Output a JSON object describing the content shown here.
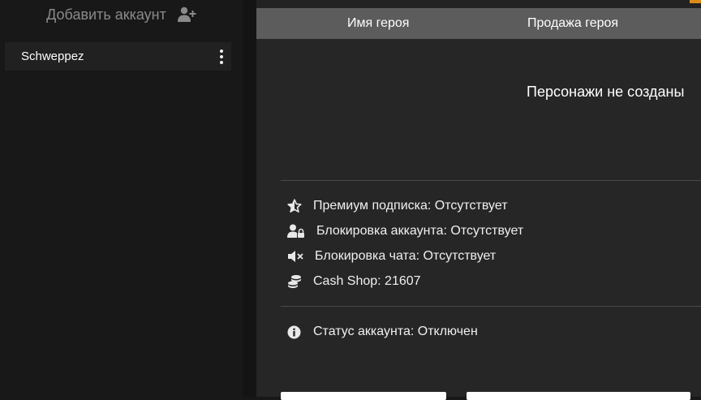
{
  "sidebar": {
    "add_account_label": "Добавить аккаунт",
    "accounts": [
      {
        "name": "Schweppez"
      }
    ]
  },
  "heroes_table": {
    "columns": [
      "Имя героя",
      "Продажа героя"
    ],
    "empty_message": "Персонажи не созданы"
  },
  "account_info": {
    "premium": "Премиум подписка: Отсутствует",
    "account_block": "Блокировка аккаунта: Отсутствует",
    "chat_block": "Блокировка чата: Отсутствует",
    "cash_shop": "Cash Shop: 21607",
    "status": "Статус аккаунта: Отключен"
  },
  "colors": {
    "accent": "#d98b1a",
    "header_bg": "#5c5c5c",
    "panel_bg": "#262626",
    "sidebar_bg": "#181818"
  },
  "icons": [
    "user-plus-icon",
    "kebab-menu-icon",
    "star-icon",
    "user-lock-icon",
    "mute-icon",
    "coins-icon",
    "info-icon"
  ]
}
